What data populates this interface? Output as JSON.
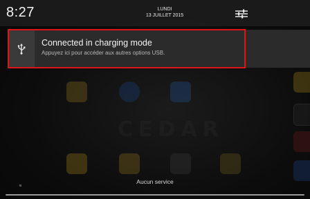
{
  "status": {
    "time": "8:27",
    "day": "LUNDI",
    "date": "13 JUILLET 2015"
  },
  "icons": {
    "settings": "sliders-icon",
    "usb": "usb-icon"
  },
  "notification": {
    "title": "Connected in charging mode",
    "text": "Appuyez ici pour accéder aux autres options USB."
  },
  "home": {
    "brand": "CEDAR"
  },
  "footer": {
    "service": "Aucun service"
  },
  "colors": {
    "highlight": "#e01414",
    "notification_bg": "#2b2b2b",
    "header_bg": "#1c1c1c"
  }
}
